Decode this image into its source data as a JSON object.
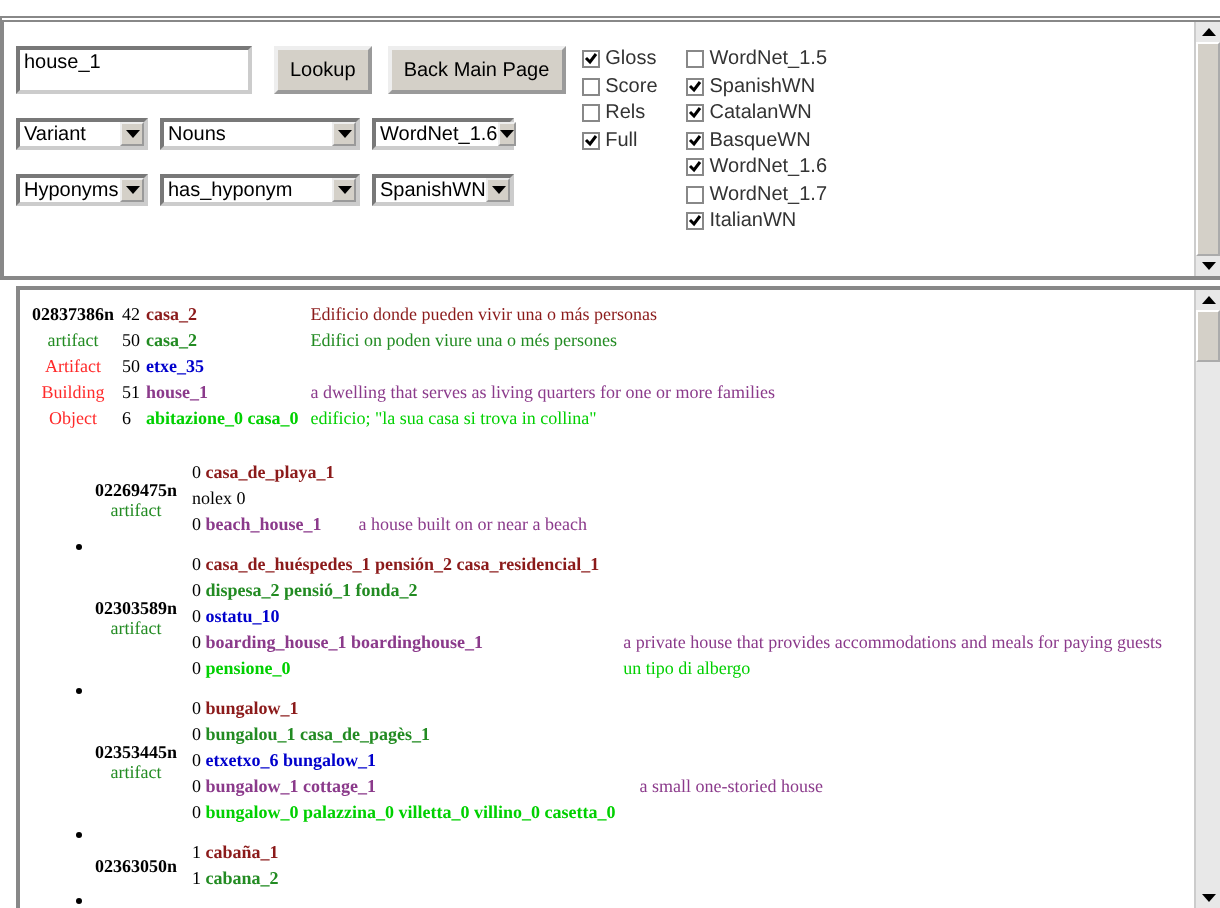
{
  "query": {
    "value": "house_1"
  },
  "buttons": [
    "Lookup",
    "Back Main Page"
  ],
  "selects": [
    [
      "Variant",
      "Nouns",
      "WordNet_1.6"
    ],
    [
      "Hyponyms",
      "has_hyponym",
      "SpanishWN"
    ]
  ],
  "options": [
    {
      "label": "Gloss",
      "checked": true
    },
    {
      "label": "Score",
      "checked": false
    },
    {
      "label": "Rels",
      "checked": false
    },
    {
      "label": "Full",
      "checked": true
    }
  ],
  "wordnets": [
    {
      "label": "WordNet_1.5",
      "checked": false
    },
    {
      "label": "SpanishWN",
      "checked": true
    },
    {
      "label": "CatalanWN",
      "checked": true
    },
    {
      "label": "BasqueWN",
      "checked": true
    },
    {
      "label": "WordNet_1.6",
      "checked": true
    },
    {
      "label": "WordNet_1.7",
      "checked": false
    },
    {
      "label": "ItalianWN",
      "checked": true
    }
  ],
  "main": {
    "id": "02837386n",
    "rows": [
      {
        "count": "42",
        "words": "casa_2",
        "color": "#8b1a1a",
        "gloss": "Edificio donde pueden vivir una o más personas"
      },
      {
        "label": {
          "text": "artifact",
          "color": "#228b22"
        },
        "count": "50",
        "words": "casa_2",
        "color": "#228b22",
        "gloss": "Edifici on poden viure una o més persones"
      },
      {
        "label": {
          "text": "Artifact",
          "color": "#ff2a2a"
        },
        "count": "50",
        "words": "etxe_35",
        "color": "#0000cc"
      },
      {
        "label": {
          "text": "Building",
          "color": "#ff2a2a"
        },
        "count": "51",
        "words": "house_1",
        "color": "#8b3a8b",
        "gloss": "a dwelling that serves as living quarters for one or more families"
      },
      {
        "label": {
          "text": "Object",
          "color": "#ff2a2a"
        },
        "count": "6",
        "words": "abitazione_0 casa_0",
        "color": "#00d000",
        "gloss": "edificio; \"la sua casa si trova in collina\""
      }
    ]
  },
  "hyponyms": [
    {
      "id": "02269475n",
      "label": "artifact",
      "lines": [
        {
          "kind": "lex",
          "count": "0",
          "words": "casa_de_playa_1",
          "color": "#8b1a1a"
        },
        {
          "kind": "nolex",
          "text": "nolex 0"
        },
        {
          "kind": "lex",
          "count": "0",
          "words": "beach_house_1",
          "color": "#8b3a8b",
          "gloss": "a house built on or near a beach"
        }
      ]
    },
    {
      "id": "02303589n",
      "label": "artifact",
      "lines": [
        {
          "kind": "lex",
          "count": "0",
          "words": "casa_de_huéspedes_1 pensión_2 casa_residencial_1",
          "color": "#8b1a1a"
        },
        {
          "kind": "lex",
          "count": "0",
          "words": "dispesa_2 pensió_1 fonda_2",
          "color": "#228b22"
        },
        {
          "kind": "lex",
          "count": "0",
          "words": "ostatu_10",
          "color": "#0000cc"
        },
        {
          "kind": "lex",
          "count": "0",
          "words": "boarding_house_1 boardinghouse_1",
          "color": "#8b3a8b",
          "gloss": "a private house that provides accommodations and meals for paying guests"
        },
        {
          "kind": "lex",
          "count": "0",
          "words": "pensione_0",
          "color": "#00d000",
          "gloss": "un tipo di albergo"
        }
      ]
    },
    {
      "id": "02353445n",
      "label": "artifact",
      "lines": [
        {
          "kind": "lex",
          "count": "0",
          "words": "bungalow_1",
          "color": "#8b1a1a"
        },
        {
          "kind": "lex",
          "count": "0",
          "words": "bungalou_1 casa_de_pagès_1",
          "color": "#228b22"
        },
        {
          "kind": "lex",
          "count": "0",
          "words": "etxetxo_6 bungalow_1",
          "color": "#0000cc"
        },
        {
          "kind": "lex",
          "count": "0",
          "words": "bungalow_1 cottage_1",
          "color": "#8b3a8b",
          "gloss": "a small one-storied house"
        },
        {
          "kind": "lex",
          "count": "0",
          "words": "bungalow_0 palazzina_0 villetta_0 villino_0 casetta_0",
          "color": "#00d000"
        }
      ]
    },
    {
      "id": "02363050n",
      "lines": [
        {
          "kind": "lex",
          "count": "1",
          "words": "cabaña_1",
          "color": "#8b1a1a"
        },
        {
          "kind": "lex",
          "count": "1",
          "words": "cabana_2",
          "color": "#228b22"
        }
      ]
    }
  ]
}
